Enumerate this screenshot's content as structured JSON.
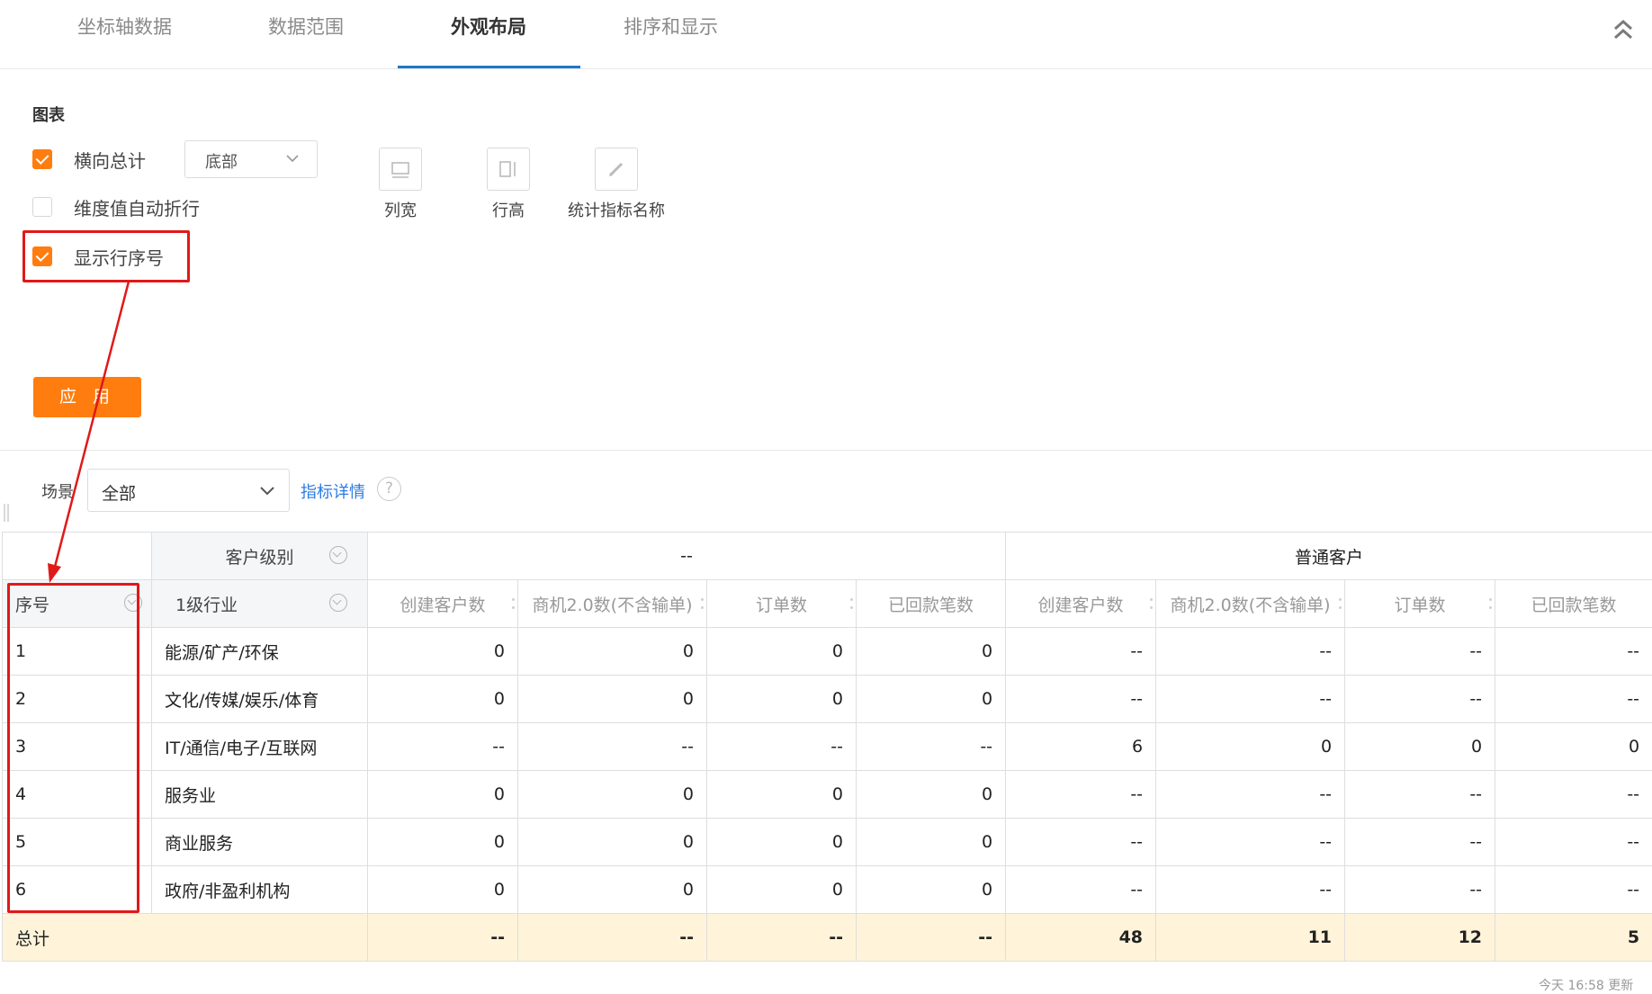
{
  "tabs": [
    {
      "label": "坐标轴数据",
      "active": false
    },
    {
      "label": "数据范围",
      "active": false
    },
    {
      "label": "外观布局",
      "active": true
    },
    {
      "label": "排序和显示",
      "active": false
    }
  ],
  "settings": {
    "section_title": "图表",
    "row_total": {
      "label": "横向总计",
      "checked": true,
      "position": "底部"
    },
    "auto_wrap": {
      "label": "维度值自动折行",
      "checked": false
    },
    "show_index": {
      "label": "显示行序号",
      "checked": true
    },
    "tools": [
      {
        "label": "列宽",
        "icon": "column-width-icon"
      },
      {
        "label": "行高",
        "icon": "row-height-icon"
      },
      {
        "label": "统计指标名称",
        "icon": "edit-pencil-icon"
      }
    ],
    "apply_label": "应 用"
  },
  "filter": {
    "scene_label": "场景",
    "scene_value": "全部",
    "detail_link": "指标详情",
    "help_glyph": "?"
  },
  "table": {
    "dim_header_customer_level": "客户级别",
    "dim_header_index": "序号",
    "dim_header_industry": "1级行业",
    "groups": [
      "--",
      "普通客户"
    ],
    "metrics": [
      "创建客户数",
      "商机2.0数(不含输单)",
      "订单数",
      "已回款笔数",
      "创建客户数",
      "商机2.0数(不含输单)",
      "订单数",
      "已回款笔数"
    ],
    "rows": [
      {
        "index": "1",
        "industry": "能源/矿产/环保",
        "values": [
          "0",
          "0",
          "0",
          "0",
          "--",
          "--",
          "--",
          "--"
        ]
      },
      {
        "index": "2",
        "industry": "文化/传媒/娱乐/体育",
        "values": [
          "0",
          "0",
          "0",
          "0",
          "--",
          "--",
          "--",
          "--"
        ]
      },
      {
        "index": "3",
        "industry": "IT/通信/电子/互联网",
        "values": [
          "--",
          "--",
          "--",
          "--",
          "6",
          "0",
          "0",
          "0"
        ]
      },
      {
        "index": "4",
        "industry": "服务业",
        "values": [
          "0",
          "0",
          "0",
          "0",
          "--",
          "--",
          "--",
          "--"
        ]
      },
      {
        "index": "5",
        "industry": "商业服务",
        "values": [
          "0",
          "0",
          "0",
          "0",
          "--",
          "--",
          "--",
          "--"
        ]
      },
      {
        "index": "6",
        "industry": "政府/非盈利机构",
        "values": [
          "0",
          "0",
          "0",
          "0",
          "--",
          "--",
          "--",
          "--"
        ]
      }
    ],
    "total": {
      "label": "总计",
      "values": [
        "--",
        "--",
        "--",
        "--",
        "48",
        "11",
        "12",
        "5"
      ]
    }
  },
  "footer_partial": "今天 16:58 更新",
  "colors": {
    "accent": "#ff7d0f",
    "tab_active": "#1f78c8",
    "annotation": "#e01919",
    "total_bg": "#fff4d9",
    "link": "#2c7be5"
  }
}
